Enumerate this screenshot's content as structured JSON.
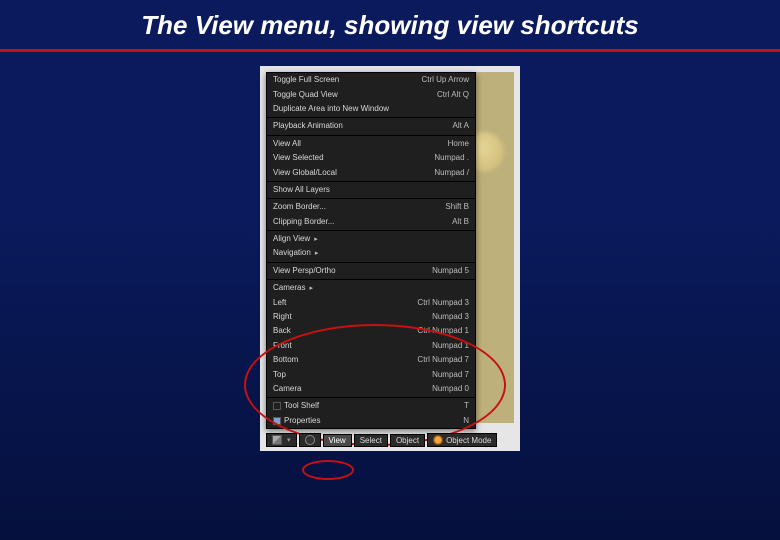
{
  "slide": {
    "title": "The View menu, showing view shortcuts"
  },
  "menu_groups": [
    [
      {
        "label": "Toggle Full Screen",
        "shortcut": "Ctrl Up Arrow"
      },
      {
        "label": "Toggle Quad View",
        "shortcut": "Ctrl Alt Q"
      },
      {
        "label": "Duplicate Area into New Window",
        "shortcut": ""
      }
    ],
    [
      {
        "label": "Playback Animation",
        "shortcut": "Alt A"
      }
    ],
    [
      {
        "label": "View All",
        "shortcut": "Home"
      },
      {
        "label": "View Selected",
        "shortcut": "Numpad ."
      },
      {
        "label": "View Global/Local",
        "shortcut": "Numpad /"
      }
    ],
    [
      {
        "label": "Show All Layers",
        "shortcut": ""
      }
    ],
    [
      {
        "label": "Zoom Border...",
        "shortcut": "Shift B"
      },
      {
        "label": "Clipping Border...",
        "shortcut": "Alt B"
      }
    ],
    [
      {
        "label": "Align View",
        "shortcut": "",
        "submenu": true
      },
      {
        "label": "Navigation",
        "shortcut": "",
        "submenu": true
      }
    ],
    [
      {
        "label": "View Persp/Ortho",
        "shortcut": "Numpad 5"
      }
    ],
    [
      {
        "label": "Cameras",
        "shortcut": "",
        "submenu": true
      },
      {
        "label": "Left",
        "shortcut": "Ctrl Numpad 3"
      },
      {
        "label": "Right",
        "shortcut": "Numpad 3"
      },
      {
        "label": "Back",
        "shortcut": "Ctrl Numpad 1"
      },
      {
        "label": "Front",
        "shortcut": "Numpad 1"
      },
      {
        "label": "Bottom",
        "shortcut": "Ctrl Numpad 7"
      },
      {
        "label": "Top",
        "shortcut": "Numpad 7"
      },
      {
        "label": "Camera",
        "shortcut": "Numpad 0"
      }
    ],
    [
      {
        "label": "Tool Shelf",
        "shortcut": "T",
        "check": false
      },
      {
        "label": "Properties",
        "shortcut": "N",
        "check": true
      }
    ]
  ],
  "footer": {
    "view": "View",
    "select": "Select",
    "object": "Object",
    "mode": "Object Mode"
  }
}
